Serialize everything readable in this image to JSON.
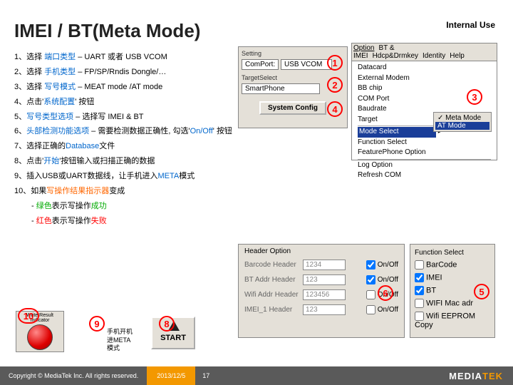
{
  "header": {
    "title": "IMEI / BT(Meta Mode)",
    "internal": "Internal Use"
  },
  "steps": {
    "s1a": "1、选择 ",
    "s1b": "端口类型",
    "s1c": " – UART 或者 USB VCOM",
    "s2a": "2、选择 ",
    "s2b": "手机类型",
    "s2c": " – FP/SP/Rndis Dongle/…",
    "s3a": "3、选择 ",
    "s3b": "写号模式",
    "s3c": " – MEAT mode /AT mode",
    "s4a": "4、点击'",
    "s4b": "系统配置",
    "s4c": "' 按钮",
    "s5a": "5、",
    "s5b": "写号类型选项",
    "s5c": " – 选择写 IMEI & BT",
    "s6a": "6、",
    "s6b": "头部检测功能选项",
    "s6c": " – 需要检测数据正确性, 勾选'",
    "s6d": "On/Off",
    "s6e": "' 按钮",
    "s7a": "7、选择正确的",
    "s7b": "Database",
    "s7c": "文件",
    "s8a": "8、点击'",
    "s8b": "开始",
    "s8c": "'按钮输入或扫描正确的数据",
    "s9a": "9、插入USB或UART数据线，让手机进入",
    "s9b": "META",
    "s9c": "模式",
    "s10a": "10、如果",
    "s10b": "写操作结果指示器",
    "s10c": "变成",
    "s10g1": "- ",
    "s10g2": "绿色",
    "s10g3": "表示写操作",
    "s10g4": "成功",
    "s10r1": "- ",
    "s10r2": "红色",
    "s10r3": "表示写操作",
    "s10r4": "失败"
  },
  "setting": {
    "title": "Setting",
    "comport_lbl": "ComPort:",
    "comport_val": "USB VCOM",
    "target_lbl": "TargetSelect",
    "target_val": "SmartPhone",
    "config_btn": "System Config"
  },
  "menu": {
    "bar": {
      "m1": "Option",
      "m2": "BT & IMEI",
      "m3": "Hdcp&Drmkey",
      "m4": "Identity",
      "m5": "Help"
    },
    "items": {
      "i1": "Datacard",
      "i2": "External Modem",
      "i3": "BB chip",
      "i4": "COM Port",
      "i5": "Baudrate",
      "i6": "Target",
      "i7": "Mode Select",
      "i8": "Function Select",
      "i9": "FeaturePhone Option",
      "i10": "Log Option",
      "i11": "Refresh COM"
    },
    "sub": {
      "a": "Meta Mode",
      "b": "AT Mode"
    }
  },
  "headerOpt": {
    "title": "Header Option",
    "r1": {
      "l": "Barcode Header",
      "v": "1234",
      "c": "On/Off"
    },
    "r2": {
      "l": "BT Addr Header",
      "v": "123",
      "c": "On/Off"
    },
    "r3": {
      "l": "Wifi Addr Header",
      "v": "123456",
      "c": "On/Off"
    },
    "r4": {
      "l": "IMEI_1 Header",
      "v": "123",
      "c": "On/Off"
    }
  },
  "func": {
    "title": "Function Select",
    "o1": "BarCode",
    "o2": "IMEI",
    "o3": "BT",
    "o4": "WIFI Mac adr",
    "o5": "Wifi EEPROM Copy"
  },
  "widgets": {
    "wri": "Write Result Indicator",
    "start": "START",
    "note9": "手机开机\n进META\n模式"
  },
  "badges": {
    "b1": "1",
    "b2": "2",
    "b3": "3",
    "b4": "4",
    "b5": "5",
    "b6": "6",
    "b8": "8",
    "b9": "9",
    "b10": "10"
  },
  "footer": {
    "cp": "Copyright © MediaTek Inc. All rights reserved.",
    "dt": "2013/12/5",
    "pg": "17",
    "logoA": "MEDIA",
    "logoB": "TEK"
  }
}
